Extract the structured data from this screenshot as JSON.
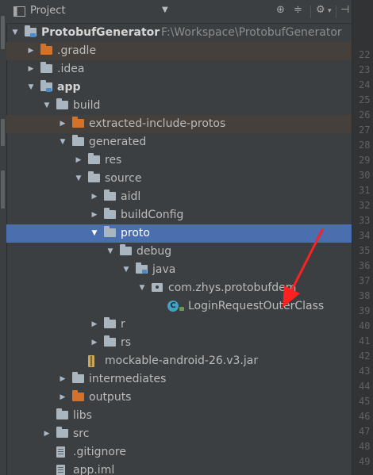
{
  "toolbar": {
    "title": "Project",
    "dropdown_icon": "triangle-down-icon",
    "actions": [
      "target-icon",
      "collapse-icon",
      "gear-icon",
      "hide-icon"
    ]
  },
  "tree": [
    {
      "label": "ProtobufGenerator",
      "detail": "F:\\Workspace\\ProtobufGenerator",
      "depth": 0,
      "arrow": "expanded",
      "icon": "module-folder-icon",
      "bold": true
    },
    {
      "label": ".gradle",
      "depth": 1,
      "arrow": "collapsed",
      "icon": "excluded-folder-icon",
      "highlight": "alt"
    },
    {
      "label": ".idea",
      "depth": 1,
      "arrow": "collapsed",
      "icon": "folder-icon"
    },
    {
      "label": "app",
      "depth": 1,
      "arrow": "expanded",
      "icon": "module-folder-icon",
      "bold": true
    },
    {
      "label": "build",
      "depth": 2,
      "arrow": "expanded",
      "icon": "folder-icon"
    },
    {
      "label": "extracted-include-protos",
      "depth": 3,
      "arrow": "collapsed",
      "icon": "excluded-folder-icon",
      "highlight": "alt"
    },
    {
      "label": "generated",
      "depth": 3,
      "arrow": "expanded",
      "icon": "folder-icon"
    },
    {
      "label": "res",
      "depth": 4,
      "arrow": "collapsed",
      "icon": "folder-icon"
    },
    {
      "label": "source",
      "depth": 4,
      "arrow": "expanded",
      "icon": "folder-icon"
    },
    {
      "label": "aidl",
      "depth": 5,
      "arrow": "collapsed",
      "icon": "folder-icon"
    },
    {
      "label": "buildConfig",
      "depth": 5,
      "arrow": "collapsed",
      "icon": "folder-icon"
    },
    {
      "label": "proto",
      "depth": 5,
      "arrow": "expanded",
      "icon": "folder-icon",
      "highlight": "selected"
    },
    {
      "label": "debug",
      "depth": 6,
      "arrow": "expanded",
      "icon": "folder-icon"
    },
    {
      "label": "java",
      "depth": 7,
      "arrow": "expanded",
      "icon": "source-folder-icon"
    },
    {
      "label": "com.zhys.protobufdem",
      "depth": 8,
      "arrow": "expanded",
      "icon": "package-icon"
    },
    {
      "label": "LoginRequestOuterClass",
      "depth": 9,
      "arrow": "none",
      "icon": "class-icon"
    },
    {
      "label": "r",
      "depth": 5,
      "arrow": "collapsed",
      "icon": "folder-icon"
    },
    {
      "label": "rs",
      "depth": 5,
      "arrow": "collapsed",
      "icon": "folder-icon"
    },
    {
      "label": "mockable-android-26.v3.jar",
      "depth": 4,
      "arrow": "none",
      "icon": "jar-icon"
    },
    {
      "label": "intermediates",
      "depth": 3,
      "arrow": "collapsed",
      "icon": "folder-icon"
    },
    {
      "label": "outputs",
      "depth": 3,
      "arrow": "collapsed",
      "icon": "excluded-folder-icon"
    },
    {
      "label": "libs",
      "depth": 2,
      "arrow": "none",
      "icon": "folder-icon"
    },
    {
      "label": "src",
      "depth": 2,
      "arrow": "collapsed",
      "icon": "folder-icon"
    },
    {
      "label": ".gitignore",
      "depth": 2,
      "arrow": "none",
      "icon": "file-icon"
    },
    {
      "label": "app.iml",
      "depth": 2,
      "arrow": "none",
      "icon": "file-icon"
    }
  ],
  "line_numbers": [
    "22",
    "23",
    "24",
    "25",
    "26",
    "27",
    "28",
    "29",
    "30",
    "31",
    "32",
    "33",
    "34",
    "35",
    "36",
    "37",
    "38",
    "39",
    "40",
    "41",
    "42",
    "43",
    "44",
    "45",
    "46",
    "47",
    "48",
    "49"
  ],
  "colors": {
    "background": "#3c3f41",
    "selection": "#4b6eaf",
    "excluded_folder": "#d4722a",
    "annotation_arrow": "#ff2020"
  }
}
